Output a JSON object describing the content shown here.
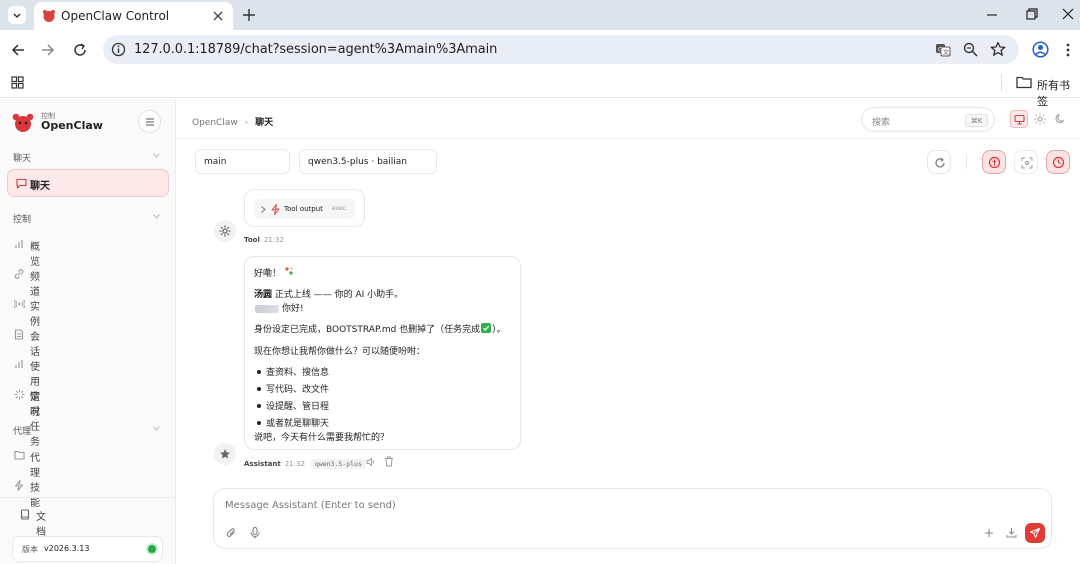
{
  "browser": {
    "tab_title": "OpenClaw Control",
    "url": "127.0.0.1:18789/chat?session=agent%3Amain%3Amain",
    "bookmarks_label": "所有书签"
  },
  "brand": {
    "subtitle": "控制",
    "name": "OpenClaw"
  },
  "sidebar": {
    "sections": [
      {
        "label": "聊天",
        "items": [
          {
            "label": "聊天",
            "icon": "chat-icon",
            "active": true
          }
        ]
      },
      {
        "label": "控制",
        "items": [
          {
            "label": "概览",
            "icon": "bar-chart-icon"
          },
          {
            "label": "频道",
            "icon": "link-icon"
          },
          {
            "label": "实例",
            "icon": "broadcast-icon"
          },
          {
            "label": "会话",
            "icon": "document-icon"
          },
          {
            "label": "使用情况",
            "icon": "bar-chart-icon"
          },
          {
            "label": "定时任务",
            "icon": "loader-icon"
          }
        ]
      },
      {
        "label": "代理",
        "items": [
          {
            "label": "代理",
            "icon": "folder-icon"
          },
          {
            "label": "技能",
            "icon": "zap-icon"
          }
        ]
      }
    ],
    "docs_label": "文档",
    "version_label": "版本",
    "version_value": "v2026.3.13"
  },
  "header": {
    "breadcrumb_root": "OpenClaw",
    "breadcrumb_current": "聊天",
    "search_placeholder": "搜索",
    "search_shortcut": "⌘K"
  },
  "chat": {
    "session_select": "main",
    "model_select": "qwen3.5-plus · bailian",
    "tool_message": {
      "label": "Tool output",
      "tag": "exec",
      "sender": "Tool",
      "time": "21:32"
    },
    "assistant_message": {
      "greeting": "好嘞！",
      "intro_name": "汤圆",
      "intro_rest": " 正式上线 —— 你的 AI 小助手。",
      "hello": "你好!",
      "setup_done": "身份设定已完成，BOOTSTRAP.md 也删掉了（任务完成",
      "setup_end": "）。",
      "question": "现在你想让我帮你做什么？可以随便吩咐：",
      "bullets": [
        "查资料、搜信息",
        "写代码、改文件",
        "设提醒、管日程",
        "或者就是聊聊天"
      ],
      "closing": "说吧，今天有什么需要我帮忙的？",
      "sender": "Assistant",
      "time": "21:32",
      "model_tag": "qwen3.5-plus"
    },
    "composer_placeholder": "Message Assistant (Enter to send)"
  },
  "colors": {
    "accent": "#e13b37",
    "accent_soft": "#fde3e3",
    "status_online": "#27a844"
  }
}
